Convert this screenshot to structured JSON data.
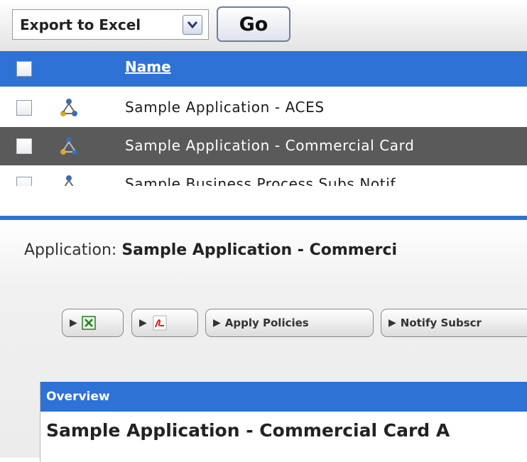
{
  "toolbar": {
    "export_select_value": "Export to Excel",
    "go_label": "Go"
  },
  "grid": {
    "columns": [
      "Name"
    ],
    "rows": [
      {
        "name": "Sample Application - ACES",
        "selected": false
      },
      {
        "name": "Sample Application - Commercial Card",
        "selected": true
      },
      {
        "name": "Sample Business Process Subs Notif",
        "selected": false
      }
    ]
  },
  "detail": {
    "title_prefix": "Application: ",
    "title_value": "Sample Application - Commerci",
    "actions": [
      {
        "label": "",
        "icon": "excel-icon"
      },
      {
        "label": "",
        "icon": "pdf-icon"
      },
      {
        "label": "Apply Policies",
        "icon": "play-icon"
      },
      {
        "label": "Notify Subscr",
        "icon": "play-icon"
      }
    ],
    "overview_header": "Overview",
    "overview_title": "Sample Application - Commercial Card A"
  },
  "colors": {
    "accent": "#2f72d6",
    "selected_row": "#5a5a5a"
  }
}
